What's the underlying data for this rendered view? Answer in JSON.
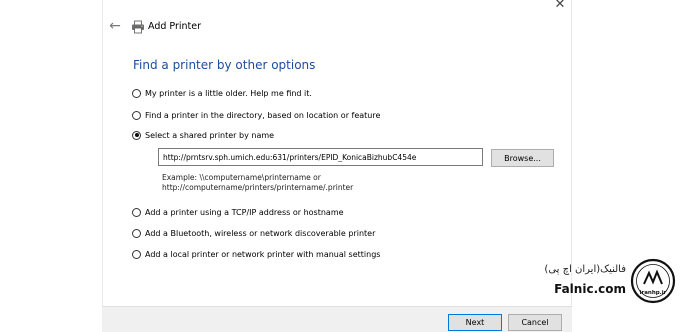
{
  "window": {
    "title": "Add Printer",
    "close_glyph": "✕",
    "back_glyph": "←"
  },
  "heading": "Find a printer by other options",
  "options": [
    {
      "label": "My printer is a little older. Help me find it.",
      "selected": false
    },
    {
      "label": "Find a printer in the directory, based on location or feature",
      "selected": false
    },
    {
      "label": "Select a shared printer by name",
      "selected": true
    },
    {
      "label": "Add a printer using a TCP/IP address or hostname",
      "selected": false
    },
    {
      "label": "Add a Bluetooth, wireless or network discoverable printer",
      "selected": false
    },
    {
      "label": "Add a local printer or network printer with manual settings",
      "selected": false
    }
  ],
  "shared_printer": {
    "value": "http://prntsrv.sph.umich.edu:631/printers/EPID_KonicaBizhubC454e",
    "browse_label": "Browse...",
    "example_line1": "Example: \\\\computername\\printername or",
    "example_line2": "http://computername/printers/printername/.printer"
  },
  "buttons": {
    "next": "Next",
    "cancel": "Cancel"
  },
  "watermark": {
    "persian_text": "فالنیک(ایران اچ پی)",
    "english_text": "Falnic.com",
    "logo_text": "iranhp.ir"
  },
  "colors": {
    "heading": "#1a4e9a",
    "accent": "#0078d7"
  },
  "icons": {
    "back": "back-arrow-icon",
    "close": "close-icon",
    "printer": "printer-icon"
  }
}
